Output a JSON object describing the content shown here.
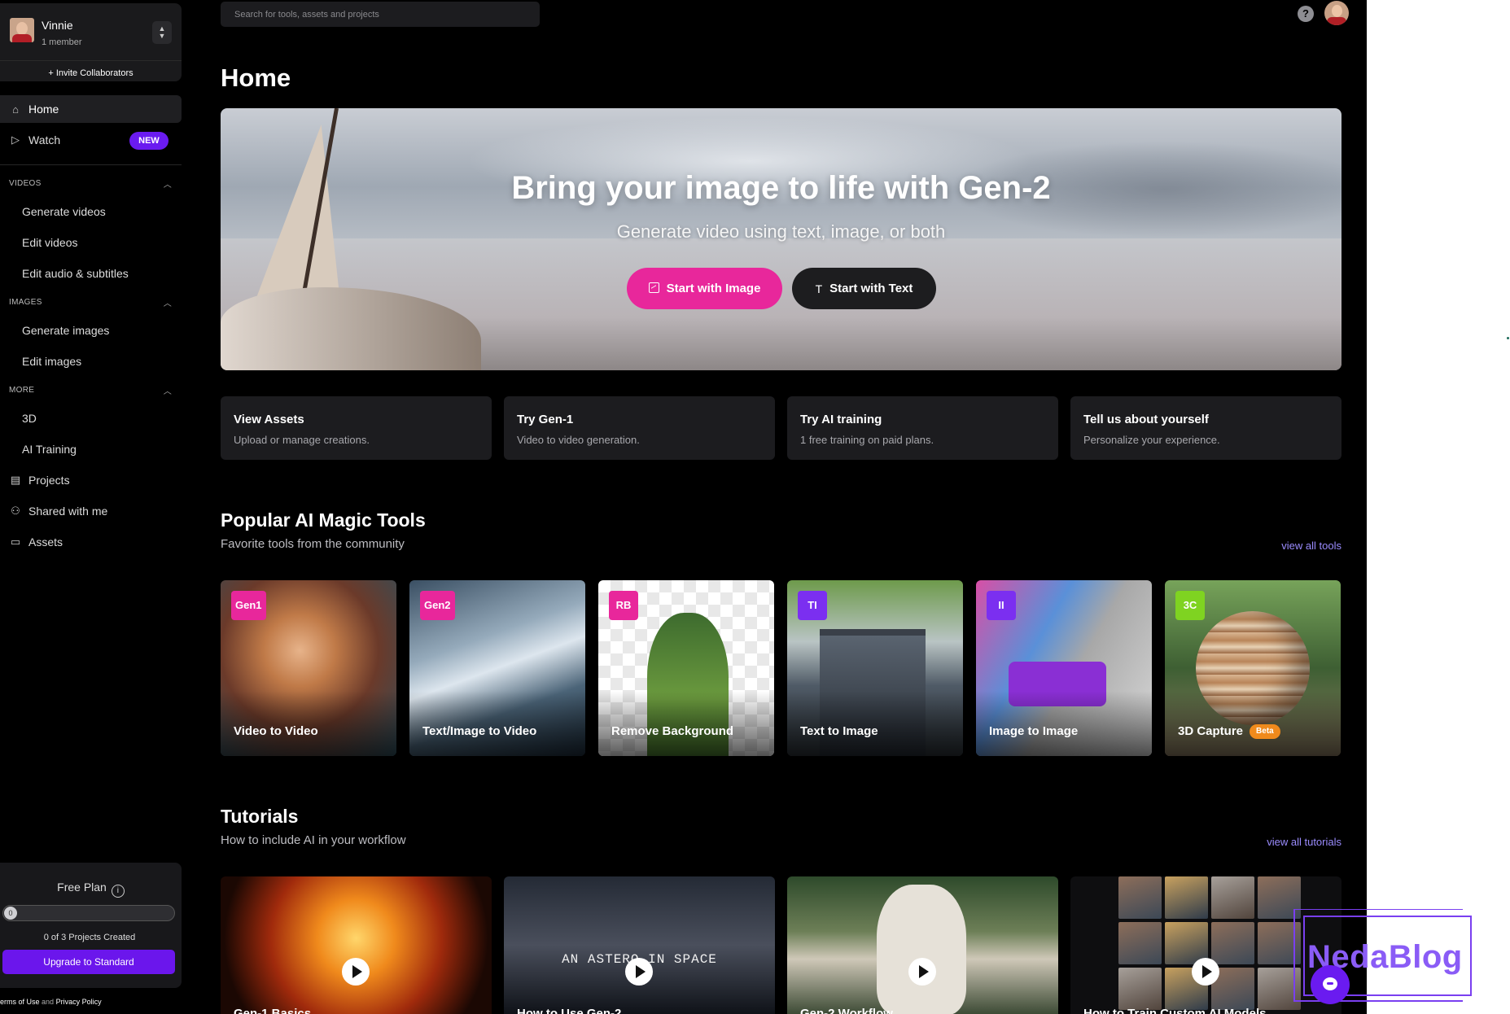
{
  "sidebar": {
    "team": {
      "name": "Vinnie",
      "members": "1 member",
      "switch_icon": "updown-chevron-icon"
    },
    "invite_label": "+ Invite Collaborators",
    "primary_nav": [
      {
        "label": "Home",
        "icon": "home-icon",
        "active": true
      },
      {
        "label": "Watch",
        "icon": "play-outline-icon",
        "badge": "NEW"
      }
    ],
    "sections": [
      {
        "title": "VIDEOS",
        "items": [
          "Generate videos",
          "Edit videos",
          "Edit audio & subtitles"
        ]
      },
      {
        "title": "IMAGES",
        "items": [
          "Generate images",
          "Edit images"
        ]
      },
      {
        "title": "MORE",
        "items": [
          "3D",
          "AI Training"
        ]
      }
    ],
    "bottom_nav": [
      {
        "label": "Projects",
        "icon": "projects-icon"
      },
      {
        "label": "Shared with me",
        "icon": "shared-users-icon"
      },
      {
        "label": "Assets",
        "icon": "folder-icon"
      }
    ],
    "plan": {
      "title": "Free Plan",
      "progress_value": "0",
      "projects_fraction": 0,
      "count_text": "0 of 3 Projects Created",
      "upgrade_label": "Upgrade to Standard"
    },
    "legal": {
      "prefix": "erms of Use",
      "and": "and",
      "privacy": "Privacy Policy"
    }
  },
  "header": {
    "search_placeholder": "Search for tools, assets and projects",
    "help_label": "?"
  },
  "main": {
    "title": "Home",
    "hero": {
      "title": "Bring your image to life with Gen-2",
      "subtitle": "Generate video using text, image, or both",
      "primary_button": "Start with Image",
      "secondary_button": "Start with Text",
      "secondary_icon_glyph": "T"
    },
    "quick_cards": [
      {
        "title": "View Assets",
        "subtitle": "Upload or manage creations."
      },
      {
        "title": "Try Gen-1",
        "subtitle": "Video to video generation."
      },
      {
        "title": "Try AI training",
        "subtitle": "1 free training on paid plans."
      },
      {
        "title": "Tell us about yourself",
        "subtitle": "Personalize your experience."
      }
    ],
    "tools_section": {
      "title": "Popular AI Magic Tools",
      "subtitle": "Favorite tools from the community",
      "view_all": "view all tools",
      "tools": [
        {
          "badge": "Gen1",
          "name": "Video to Video",
          "badge_color": "#e8279b"
        },
        {
          "badge": "Gen2",
          "name": "Text/Image to Video",
          "badge_color": "#e8279b"
        },
        {
          "badge": "RB",
          "name": "Remove Background",
          "badge_color": "#e8279b"
        },
        {
          "badge": "TI",
          "name": "Text to Image",
          "badge_color": "#7b2ff0"
        },
        {
          "badge": "II",
          "name": "Image to Image",
          "badge_color": "#7b2ff0"
        },
        {
          "badge": "3C",
          "name": "3D Capture",
          "badge_color": "#7fd321",
          "tag": "Beta"
        }
      ]
    },
    "tutorials_section": {
      "title": "Tutorials",
      "subtitle": "How to include AI in your workflow",
      "view_all": "view all tutorials",
      "tutorials": [
        {
          "caption": "Gen-1 Basics"
        },
        {
          "caption": "How to Use Gen-2",
          "overlay_text": "AN ASTERO  IN SPACE"
        },
        {
          "caption": "Gen-2 Workflow"
        },
        {
          "caption": "How to Train Custom AI Models"
        }
      ]
    }
  },
  "watermark": {
    "text": "NedaBlog"
  },
  "colors": {
    "accent_purple": "#6a1bf0",
    "accent_pink": "#e8279b",
    "link": "#9b8cff",
    "beta_orange": "#f08a1c"
  }
}
